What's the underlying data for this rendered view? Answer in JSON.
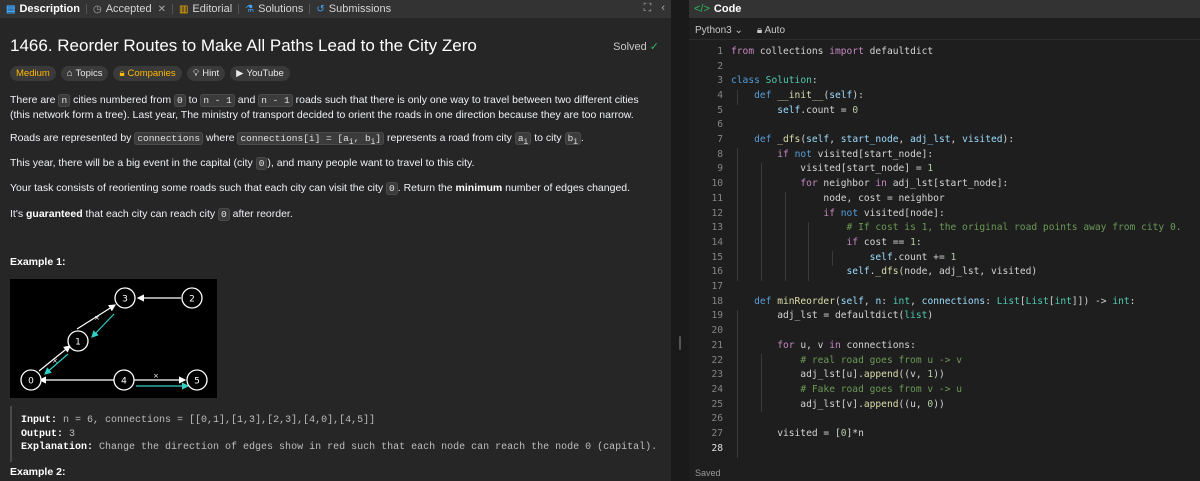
{
  "tabs": {
    "description": "Description",
    "accepted": "Accepted",
    "editorial": "Editorial",
    "solutions": "Solutions",
    "submissions": "Submissions"
  },
  "problem": {
    "title": "1466. Reorder Routes to Make All Paths Lead to the City Zero",
    "solved": "Solved",
    "tags": [
      "Medium",
      "Topics",
      "Companies",
      "Hint",
      "YouTube"
    ],
    "example1_label": "Example 1:",
    "example2_label": "Example 2:",
    "example1": {
      "input_label": "Input:",
      "input_value": "n = 6, connections = [[0,1],[1,3],[2,3],[4,0],[4,5]]",
      "output_label": "Output:",
      "output_value": "3",
      "explanation_label": "Explanation:",
      "explanation_value": "Change the direction of edges show in red such that each node can reach the node 0 (capital)."
    },
    "graph_nodes": [
      "0",
      "1",
      "2",
      "3",
      "4",
      "5"
    ]
  },
  "code_panel": {
    "tab_title": "Code",
    "language": "Python3",
    "auto": "Auto",
    "saved": "Saved",
    "line_numbers": [
      "1",
      "2",
      "3",
      "4",
      "5",
      "6",
      "7",
      "8",
      "9",
      "10",
      "11",
      "12",
      "13",
      "14",
      "15",
      "16",
      "17",
      "18",
      "19",
      "20",
      "21",
      "22",
      "23",
      "24",
      "25",
      "26",
      "27",
      "28"
    ]
  },
  "colors": {
    "accent_green": "#2cbb5d",
    "medium_yellow": "#ffb800",
    "teal_arrow": "#2fd0c6"
  }
}
